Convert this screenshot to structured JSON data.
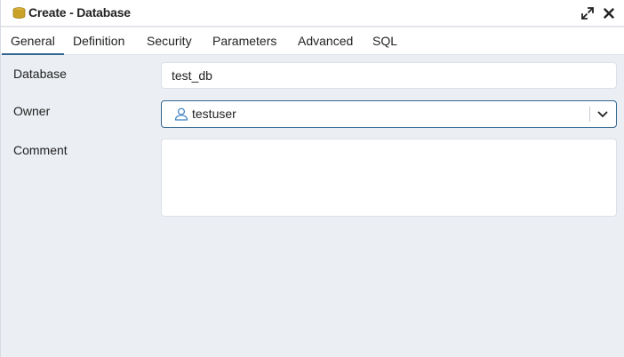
{
  "dialog": {
    "title": "Create - Database",
    "title_icon": "database-icon",
    "expand_icon": "expand-icon",
    "close_icon": "close-icon"
  },
  "tabs": [
    {
      "label": "General",
      "active": true
    },
    {
      "label": "Definition",
      "active": false
    },
    {
      "label": "Security",
      "active": false
    },
    {
      "label": "Parameters",
      "active": false
    },
    {
      "label": "Advanced",
      "active": false
    },
    {
      "label": "SQL",
      "active": false
    }
  ],
  "form": {
    "database_label": "Database",
    "database_value": "test_db",
    "owner_label": "Owner",
    "owner_value": "testuser",
    "owner_icon": "user-icon",
    "comment_label": "Comment",
    "comment_value": ""
  },
  "colors": {
    "accent": "#326690",
    "panel_bg": "#ebeef3",
    "field_border": "#dde0e6",
    "db_icon": "#c9a227"
  }
}
